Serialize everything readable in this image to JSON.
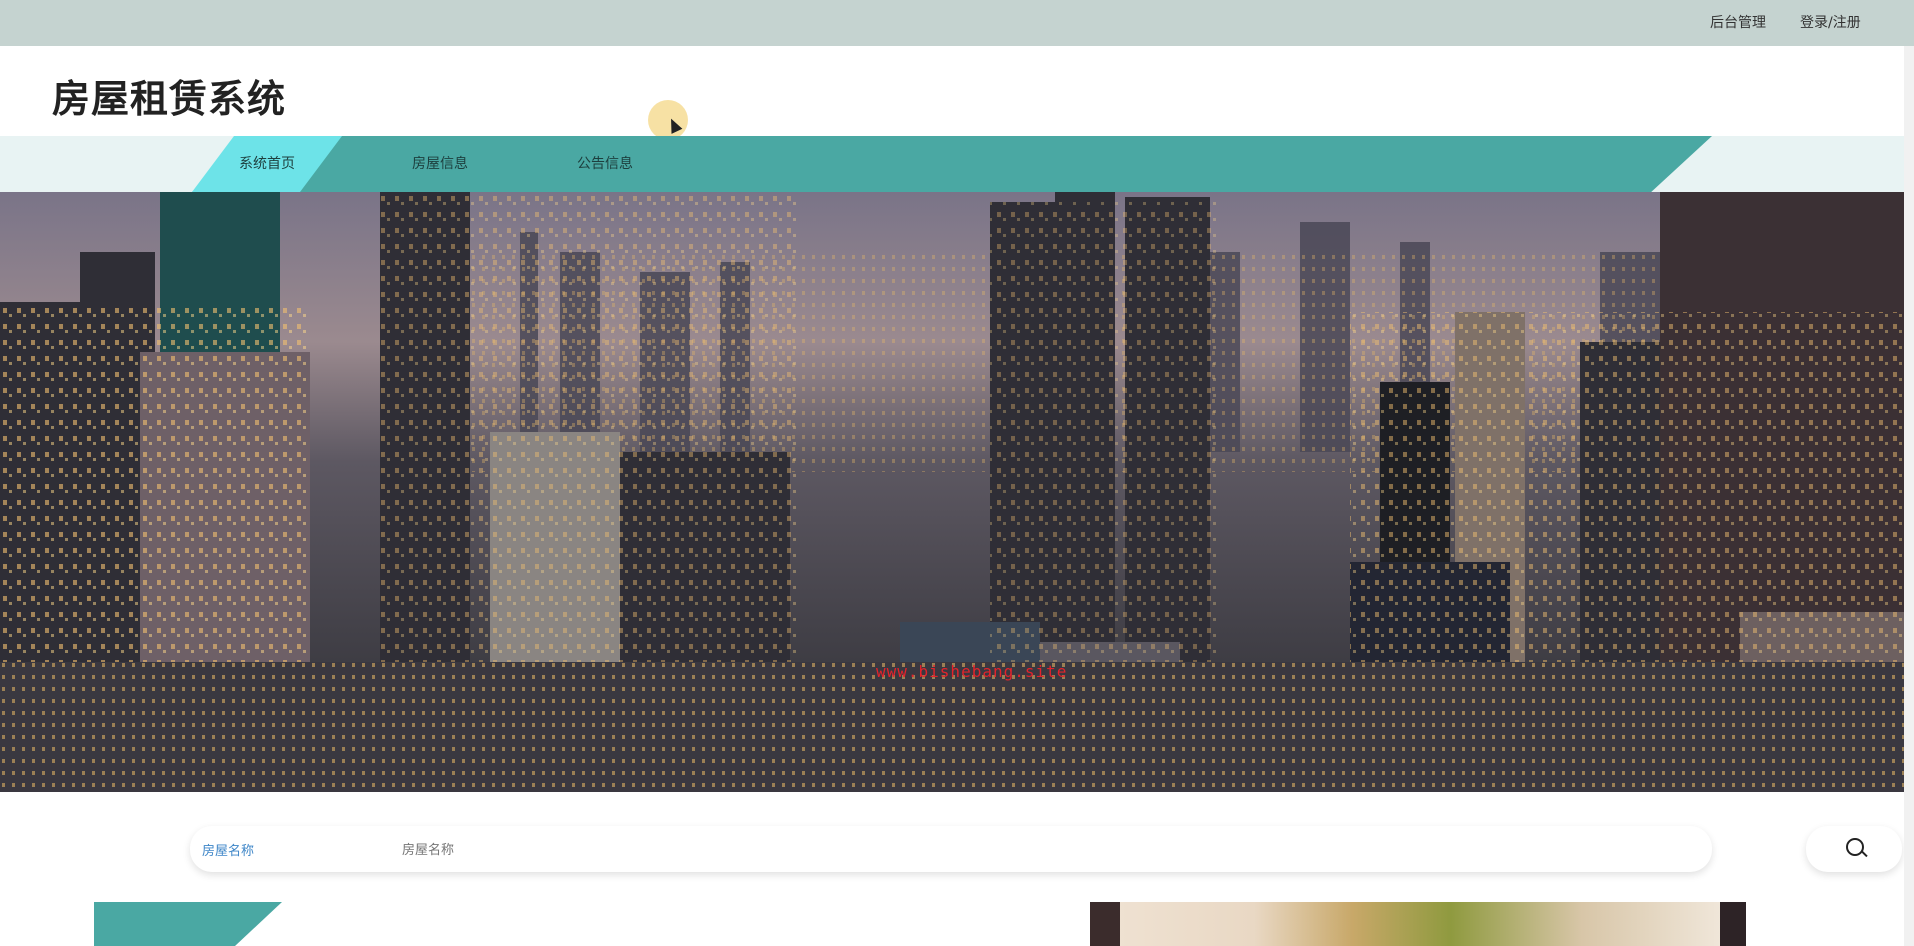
{
  "topbar": {
    "admin_label": "后台管理",
    "login_label": "登录/注册"
  },
  "header": {
    "title": "房屋租赁系统"
  },
  "nav": {
    "items": [
      {
        "label": "系统首页",
        "active": true
      },
      {
        "label": "房屋信息",
        "active": false
      },
      {
        "label": "公告信息",
        "active": false
      }
    ]
  },
  "banner": {
    "watermark": "www.bishebang.site"
  },
  "search": {
    "label": "房屋名称",
    "placeholder": "房屋名称",
    "icon": "search-icon"
  },
  "colors": {
    "topbar": "#c5d3d0",
    "nav_teal": "#4aa8a3",
    "nav_active": "#6de3e8",
    "search_label": "#3e86c8"
  }
}
